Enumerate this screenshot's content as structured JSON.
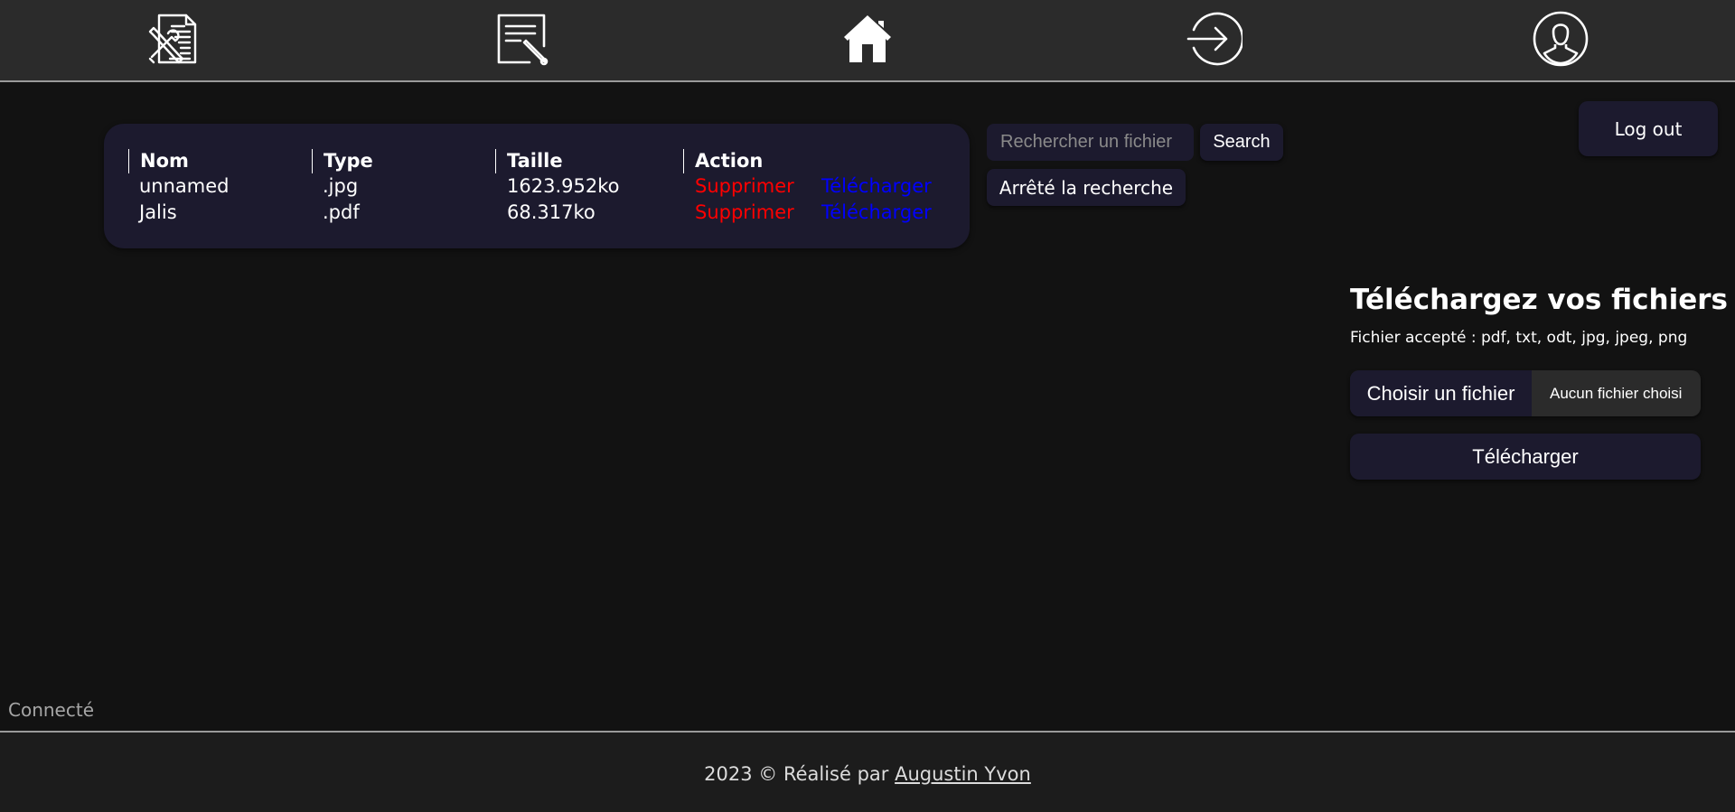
{
  "nav": {
    "items": [
      {
        "icon": "tools-document-icon"
      },
      {
        "icon": "edit-document-icon"
      },
      {
        "icon": "home-icon"
      },
      {
        "icon": "login-arrow-icon"
      },
      {
        "icon": "user-profile-icon"
      }
    ]
  },
  "files": {
    "headers": [
      "Nom",
      "Type",
      "Taille",
      "Action"
    ],
    "rows": [
      {
        "name": "unnamed",
        "type": ".jpg",
        "size": "1623.952ko",
        "delete": "Supprimer",
        "download": "Télécharger"
      },
      {
        "name": "Jalis",
        "type": ".pdf",
        "size": "68.317ko",
        "delete": "Supprimer",
        "download": "Télécharger"
      }
    ]
  },
  "search": {
    "placeholder": "Rechercher un fichier",
    "value": "",
    "button": "Search",
    "stop_button": "Arrêté la recherche"
  },
  "logout": "Log out",
  "upload": {
    "title": "Téléchargez vos fichiers",
    "accepted": "Fichier accepté : pdf, txt, odt, jpg, jpeg, png",
    "choose_button": "Choisir un fichier",
    "no_file": "Aucun fichier choisi",
    "submit": "Télécharger"
  },
  "status": "Connecté",
  "footer": {
    "prefix": "2023 © Réalisé par ",
    "author": "Augustin Yvon"
  },
  "colors": {
    "background": "#121212",
    "nav_bg": "#2b2b2b",
    "card_bg": "#1c1a2e",
    "delete": "#ff0000",
    "download": "#0000ff"
  }
}
